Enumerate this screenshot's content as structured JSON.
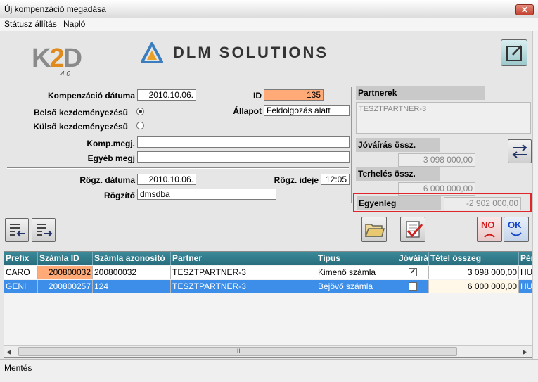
{
  "window": {
    "title": "Új kompenzáció megadása",
    "close_glyph": "✕"
  },
  "menu": [
    {
      "label": "Státusz állítás"
    },
    {
      "label": "Napló"
    }
  ],
  "logo": {
    "k2d_k": "K",
    "k2d_2": "2",
    "k2d_d": "D",
    "k2d_version": "4.0",
    "dlm": "DLM SOLUTIONS"
  },
  "form": {
    "date_label": "Kompenzáció dátuma",
    "date_value": "2010.10.06.",
    "id_label": "ID",
    "id_value": "135",
    "internal_label": "Belső kezdeményezésű",
    "state_label": "Állapot",
    "state_value": "Feldolgozás alatt",
    "external_label": "Külső kezdeményezésű",
    "komp_label": "Komp.megj.",
    "komp_value": "",
    "other_label": "Egyéb megj",
    "other_value": "",
    "rec_date_label": "Rögz. dátuma",
    "rec_date_value": "2010.10.06.",
    "rec_time_label": "Rögz. ideje",
    "rec_time_value": "12:05",
    "recorder_label": "Rögzítő",
    "recorder_value": "dmsdba",
    "id_color": "#ffaa77"
  },
  "partner": {
    "header": "Partnerek",
    "name": "TESZTPARTNER-3",
    "credit_label": "Jóváírás össz.",
    "credit_value": "3 098 000,00",
    "debit_label": "Terhelés össz.",
    "debit_value": "6 000 000,00",
    "balance_label": "Egyenleg",
    "balance_value": "-2 902 000,00",
    "highlight_color": "#e0262a"
  },
  "buttons": {
    "no_label": "NO",
    "ok_label": "OK"
  },
  "grid": {
    "headers": [
      "Prefix",
      "Számla ID",
      "Számla azonosító",
      "Partner",
      "Típus",
      "Jóváírás",
      "Tétel összeg",
      "Pénznem"
    ],
    "rows": [
      {
        "prefix": "CARO",
        "szamla_id": "200800032",
        "azon": "200800032",
        "partner": "TESZTPARTNER-3",
        "tipus": "Kimenő számla",
        "jovairas": true,
        "osszeg": "3 098 000,00",
        "penznem": "HUF"
      },
      {
        "prefix": "GENI",
        "szamla_id": "200800257",
        "azon": "124",
        "partner": "TESZTPARTNER-3",
        "tipus": "Bejövő számla",
        "jovairas": false,
        "osszeg": "6 000 000,00",
        "penznem": "HUF"
      }
    ],
    "scroll_thumb": "III"
  },
  "status": {
    "text": "Mentés"
  }
}
